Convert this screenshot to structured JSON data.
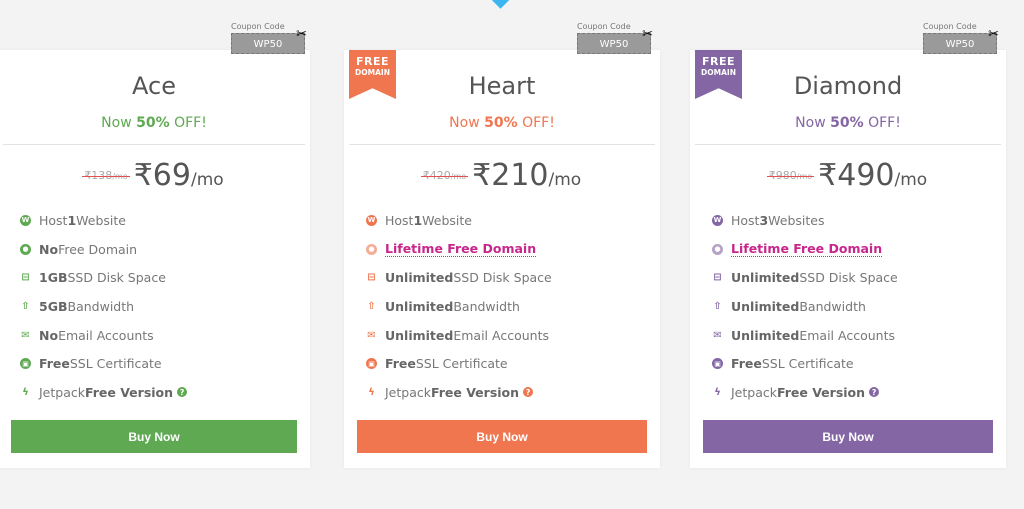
{
  "plans": [
    {
      "name": "Ace",
      "accent": "#5ea951",
      "off_prefix": "Now ",
      "off_value": "50%",
      "off_suffix": " OFF!",
      "old_price": "₹138",
      "old_unit": "/mo",
      "price": "₹69",
      "unit": "/mo",
      "coupon_label": "Coupon Code",
      "coupon_code": "WP50",
      "ribbon": null,
      "features": [
        {
          "icon": "wordpress-icon",
          "pre": "Host ",
          "bold": "1",
          "post": " Website"
        },
        {
          "icon": "globe-icon",
          "pre": "",
          "bold": "No",
          "post": " Free Domain"
        },
        {
          "icon": "hdd-icon",
          "pre": "",
          "bold": "1GB",
          "post": " SSD Disk Space"
        },
        {
          "icon": "upload-icon",
          "pre": "",
          "bold": "5GB",
          "post": " Bandwidth"
        },
        {
          "icon": "envelope-icon",
          "pre": "",
          "bold": "No",
          "post": " Email Accounts"
        },
        {
          "icon": "lock-icon",
          "pre": "",
          "bold": "Free",
          "post": " SSL Certificate"
        },
        {
          "icon": "bolt-icon",
          "pre": "Jetpack ",
          "bold": "Free Version",
          "post": "",
          "help": true
        }
      ],
      "button": "Buy Now"
    },
    {
      "name": "Heart",
      "accent": "#ef764f",
      "off_prefix": "Now ",
      "off_value": "50%",
      "off_suffix": " OFF!",
      "old_price": "₹420",
      "old_unit": "/mo",
      "price": "₹210",
      "unit": "/mo",
      "coupon_label": "Coupon Code",
      "coupon_code": "WP50",
      "ribbon": {
        "line1": "FREE",
        "line2": "DOMAIN"
      },
      "features": [
        {
          "icon": "wordpress-icon",
          "pre": "Host ",
          "bold": "1",
          "post": " Website"
        },
        {
          "icon": "globe-icon",
          "link": "Lifetime Free Domain"
        },
        {
          "icon": "hdd-icon",
          "pre": "",
          "bold": "Unlimited",
          "post": " SSD Disk Space"
        },
        {
          "icon": "upload-icon",
          "pre": "",
          "bold": "Unlimited",
          "post": " Bandwidth"
        },
        {
          "icon": "envelope-icon",
          "pre": "",
          "bold": "Unlimited",
          "post": " Email Accounts"
        },
        {
          "icon": "lock-icon",
          "pre": "",
          "bold": "Free",
          "post": " SSL Certificate"
        },
        {
          "icon": "bolt-icon",
          "pre": "Jetpack ",
          "bold": "Free Version",
          "post": "",
          "help": true
        }
      ],
      "button": "Buy Now"
    },
    {
      "name": "Diamond",
      "accent": "#8366a3",
      "off_prefix": "Now ",
      "off_value": "50%",
      "off_suffix": " OFF!",
      "old_price": "₹980",
      "old_unit": "/mo",
      "price": "₹490",
      "unit": "/mo",
      "coupon_label": "Coupon Code",
      "coupon_code": "WP50",
      "ribbon": {
        "line1": "FREE",
        "line2": "DOMAIN"
      },
      "features": [
        {
          "icon": "wordpress-icon",
          "pre": "Host ",
          "bold": "3",
          "post": " Websites"
        },
        {
          "icon": "globe-icon",
          "link": "Lifetime Free Domain"
        },
        {
          "icon": "hdd-icon",
          "pre": "",
          "bold": "Unlimited",
          "post": " SSD Disk Space"
        },
        {
          "icon": "upload-icon",
          "pre": "",
          "bold": "Unlimited",
          "post": " Bandwidth"
        },
        {
          "icon": "envelope-icon",
          "pre": "",
          "bold": "Unlimited",
          "post": " Email Accounts"
        },
        {
          "icon": "lock-icon",
          "pre": "",
          "bold": "Free",
          "post": " SSL Certificate"
        },
        {
          "icon": "bolt-icon",
          "pre": "Jetpack ",
          "bold": "Free Version",
          "post": "",
          "help": true
        }
      ],
      "button": "Buy Now"
    }
  ],
  "icons": {
    "wordpress-icon": "W",
    "globe-icon": "●",
    "hdd-icon": "⊟",
    "upload-icon": "⇧",
    "envelope-icon": "✉",
    "lock-icon": "🔒",
    "bolt-icon": "ϟ",
    "scissors-icon": "✂",
    "help-icon": "?"
  }
}
